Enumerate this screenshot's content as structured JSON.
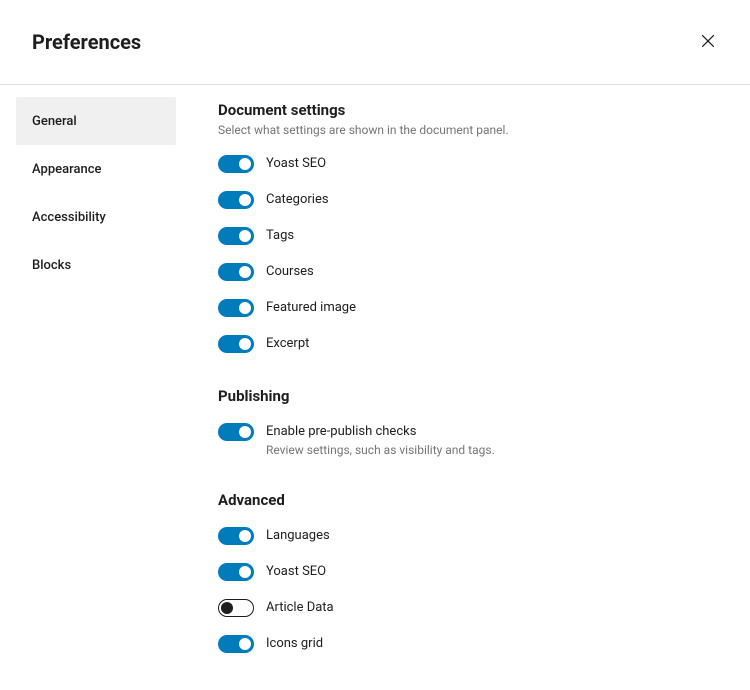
{
  "header": {
    "title": "Preferences"
  },
  "sidebar": {
    "tabs": [
      {
        "label": "General",
        "active": true
      },
      {
        "label": "Appearance",
        "active": false
      },
      {
        "label": "Accessibility",
        "active": false
      },
      {
        "label": "Blocks",
        "active": false
      }
    ]
  },
  "sections": {
    "document": {
      "title": "Document settings",
      "desc": "Select what settings are shown in the document panel.",
      "toggles": [
        {
          "label": "Yoast SEO",
          "on": true
        },
        {
          "label": "Categories",
          "on": true
        },
        {
          "label": "Tags",
          "on": true
        },
        {
          "label": "Courses",
          "on": true
        },
        {
          "label": "Featured image",
          "on": true
        },
        {
          "label": "Excerpt",
          "on": true
        }
      ]
    },
    "publishing": {
      "title": "Publishing",
      "toggles": [
        {
          "label": "Enable pre-publish checks",
          "sub": "Review settings, such as visibility and tags.",
          "on": true
        }
      ]
    },
    "advanced": {
      "title": "Advanced",
      "toggles": [
        {
          "label": "Languages",
          "on": true
        },
        {
          "label": "Yoast SEO",
          "on": true
        },
        {
          "label": "Article Data",
          "on": false
        },
        {
          "label": "Icons grid",
          "on": true
        }
      ]
    }
  }
}
